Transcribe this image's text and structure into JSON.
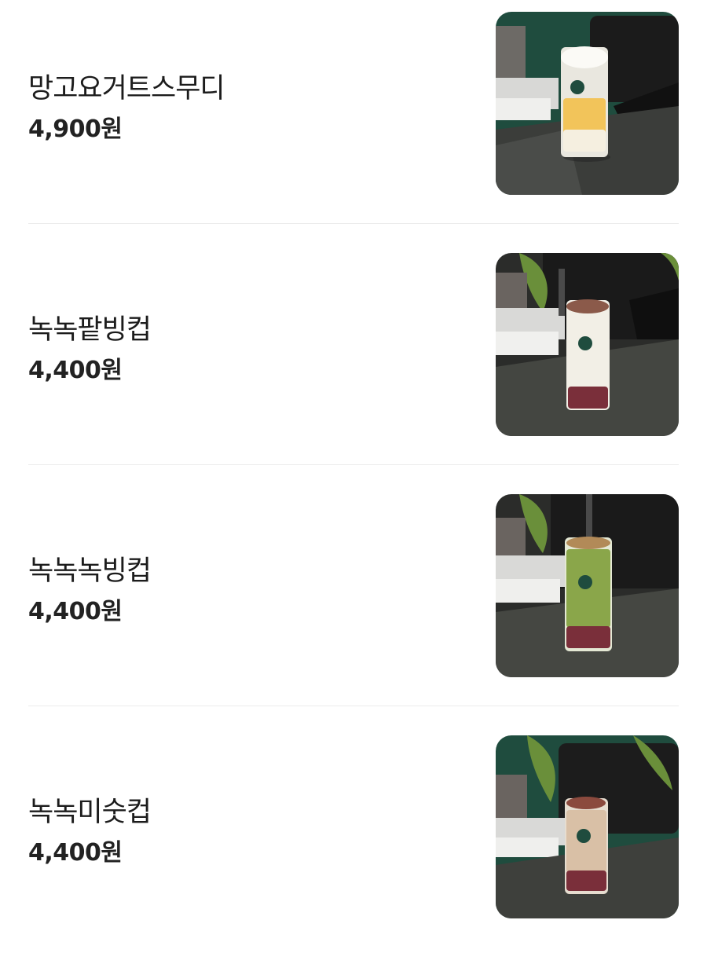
{
  "menu": {
    "items": [
      {
        "name": "망고요거트스무디",
        "price": "4,900원",
        "drink": "mango-yogurt-smoothie"
      },
      {
        "name": "녹녹팥빙컵",
        "price": "4,400원",
        "drink": "red-bean-bingsu-cup"
      },
      {
        "name": "녹녹녹빙컵",
        "price": "4,400원",
        "drink": "green-tea-bingsu-cup"
      },
      {
        "name": "녹녹미숫컵",
        "price": "4,400원",
        "drink": "misugaru-bingsu-cup"
      }
    ]
  },
  "colors": {
    "background": "#ffffff",
    "text_primary": "#1c1c1c",
    "divider": "#ececec",
    "photo_wall": "#1e4a3c",
    "photo_table": "#3d3f3c",
    "mango": "#f2c45a",
    "red_bean": "#7a2f3a",
    "matcha": "#8aa64a",
    "misugaru": "#d9c0a6"
  }
}
